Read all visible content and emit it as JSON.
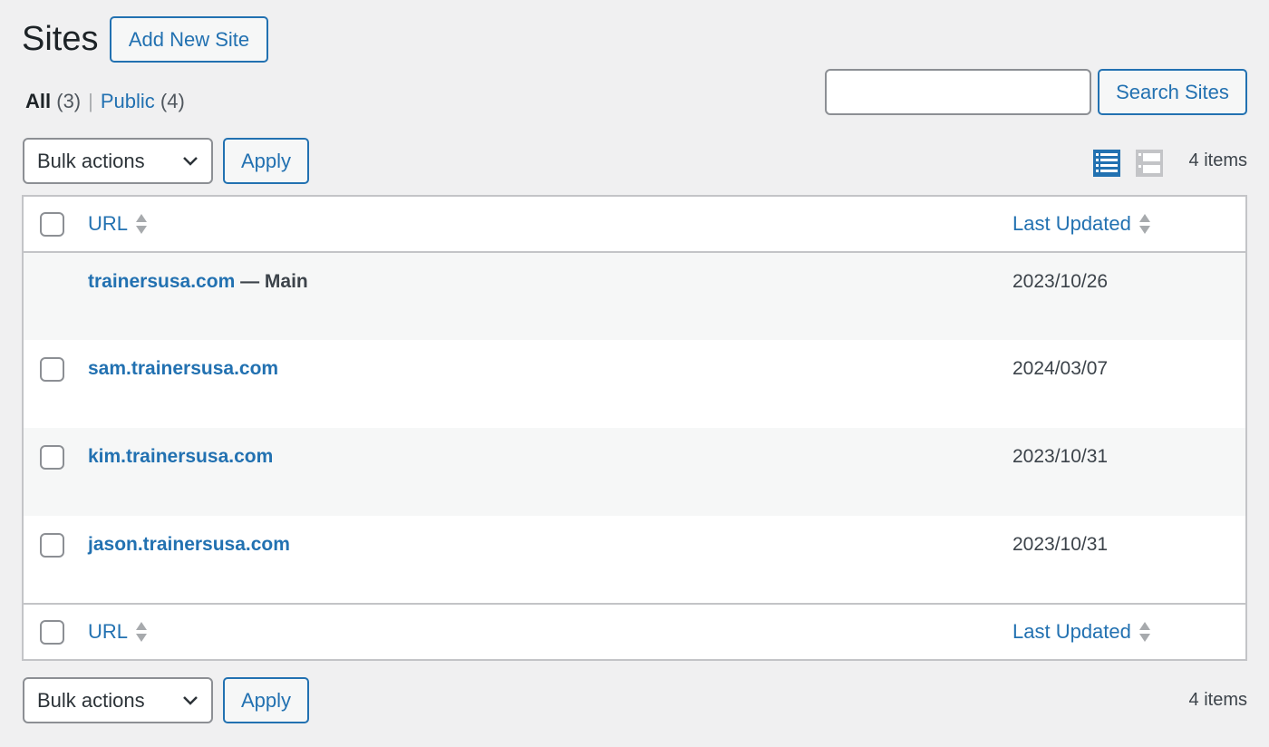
{
  "page": {
    "title": "Sites",
    "add_new_label": "Add New Site"
  },
  "views": [
    {
      "label": "All",
      "count": "(3)"
    },
    {
      "label": "Public",
      "count": "(4)"
    }
  ],
  "views_separator": "|",
  "search": {
    "value": "",
    "placeholder": "",
    "button_label": "Search Sites"
  },
  "bulk": {
    "selected": "Bulk actions",
    "apply_label": "Apply"
  },
  "view_modes": {
    "active": "list-view-icon",
    "inactive": "excerpt-view-icon"
  },
  "items_count": "4 items",
  "columns": {
    "url": "URL",
    "last_updated": "Last Updated"
  },
  "rows": [
    {
      "url": "trainersusa.com",
      "suffix": "— Main",
      "date": "2023/10/26",
      "checkbox": false
    },
    {
      "url": "sam.trainersusa.com",
      "suffix": "",
      "date": "2024/03/07",
      "checkbox": true
    },
    {
      "url": "kim.trainersusa.com",
      "suffix": "",
      "date": "2023/10/31",
      "checkbox": true
    },
    {
      "url": "jason.trainersusa.com",
      "suffix": "",
      "date": "2023/10/31",
      "checkbox": true
    }
  ],
  "colors": {
    "accent": "#2271b1",
    "background": "#f0f0f1"
  }
}
